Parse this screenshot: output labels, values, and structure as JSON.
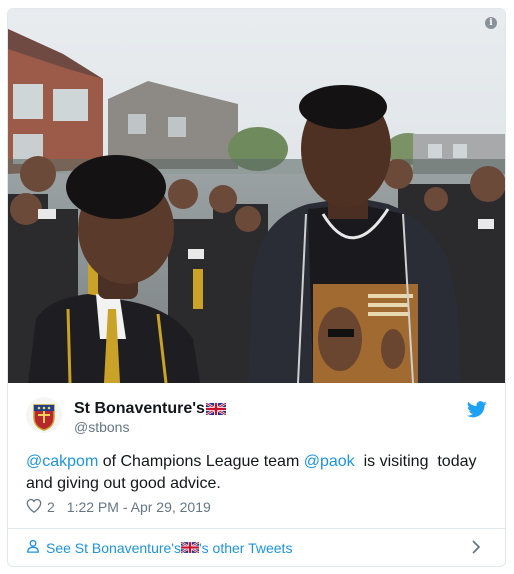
{
  "media": {
    "alt": "Photo of a footballer talking with uniformed schoolboys in a schoolyard",
    "info_symbol": "i"
  },
  "author": {
    "name": "St Bonaventure's",
    "handle": "@stbons",
    "avatar_icon": "school-crest-icon",
    "flag_icon": "union-jack-flag-icon"
  },
  "tweet": {
    "mention1": "@cakpom",
    "text1": " of Champions League team ",
    "mention2": "@paok",
    "text2": "  is visiting  today and giving out good advice."
  },
  "meta": {
    "like_count": "2",
    "timestamp": "1:22 PM - Apr 29, 2019"
  },
  "footer": {
    "prefix": "See St Bonaventure's",
    "suffix": "'s other Tweets"
  },
  "colors": {
    "link": "#1b95e0",
    "secondary_text": "#657786",
    "border": "#e1e8ed"
  }
}
